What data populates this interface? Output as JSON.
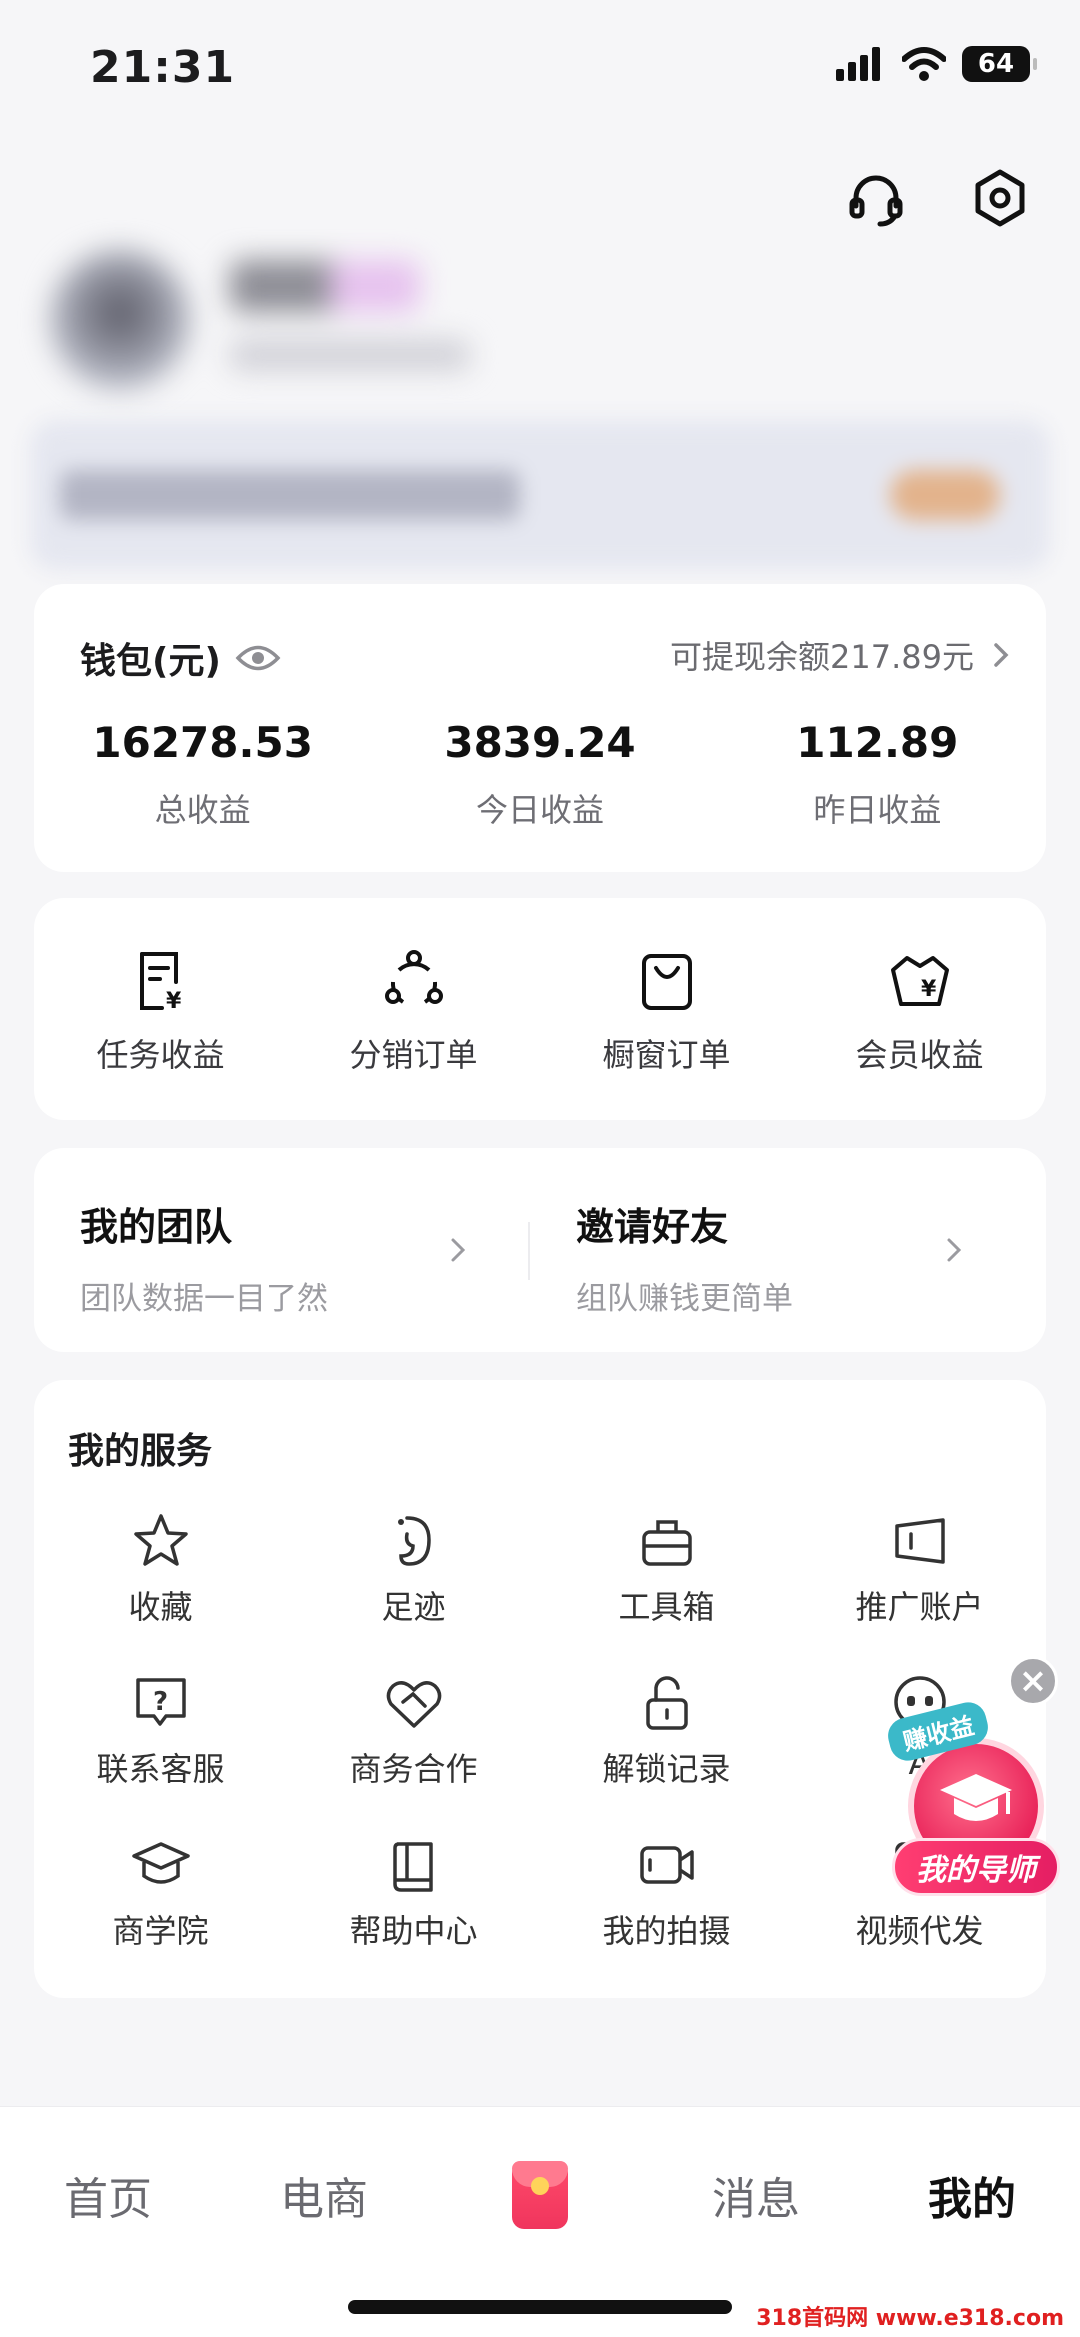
{
  "status_bar": {
    "time": "21:31",
    "battery": "64"
  },
  "wallet": {
    "title": "钱包(元)",
    "withdraw_text": "可提现余额217.89元",
    "stats": [
      {
        "value": "16278.53",
        "label": "总收益"
      },
      {
        "value": "3839.24",
        "label": "今日收益"
      },
      {
        "value": "112.89",
        "label": "昨日收益"
      }
    ]
  },
  "orders": [
    {
      "label": "任务收益",
      "icon": "task-income-icon"
    },
    {
      "label": "分销订单",
      "icon": "distribution-icon"
    },
    {
      "label": "橱窗订单",
      "icon": "shopping-bag-icon"
    },
    {
      "label": "会员收益",
      "icon": "vip-income-icon"
    }
  ],
  "team": {
    "my_team_title": "我的团队",
    "my_team_sub": "团队数据一目了然",
    "invite_title": "邀请好友",
    "invite_sub": "组队赚钱更简单"
  },
  "services": {
    "title": "我的服务",
    "items": [
      {
        "label": "收藏",
        "icon": "star-icon"
      },
      {
        "label": "足迹",
        "icon": "footprint-icon"
      },
      {
        "label": "工具箱",
        "icon": "toolbox-icon"
      },
      {
        "label": "推广账户",
        "icon": "promo-account-icon"
      },
      {
        "label": "联系客服",
        "icon": "help-chat-icon"
      },
      {
        "label": "商务合作",
        "icon": "handshake-heart-icon"
      },
      {
        "label": "解锁记录",
        "icon": "unlock-icon"
      },
      {
        "label": "A",
        "icon": "robot-icon"
      },
      {
        "label": "商学院",
        "icon": "graduation-cap-icon"
      },
      {
        "label": "帮助中心",
        "icon": "book-icon"
      },
      {
        "label": "我的拍摄",
        "icon": "video-camera-icon"
      },
      {
        "label": "视频代发",
        "icon": "video-share-icon"
      }
    ]
  },
  "floating": {
    "tag": "赚收益",
    "label": "我的导师",
    "close": "×"
  },
  "bottom_nav": [
    {
      "label": "首页"
    },
    {
      "label": "电商"
    },
    {
      "label": "",
      "icon": "red-packet-icon"
    },
    {
      "label": "消息"
    },
    {
      "label": "我的",
      "active": true
    }
  ],
  "watermark": "318首码网 www.e318.com",
  "colors": {
    "accent": "#e9245a",
    "text_primary": "#111111",
    "text_secondary": "#6e6e74"
  }
}
